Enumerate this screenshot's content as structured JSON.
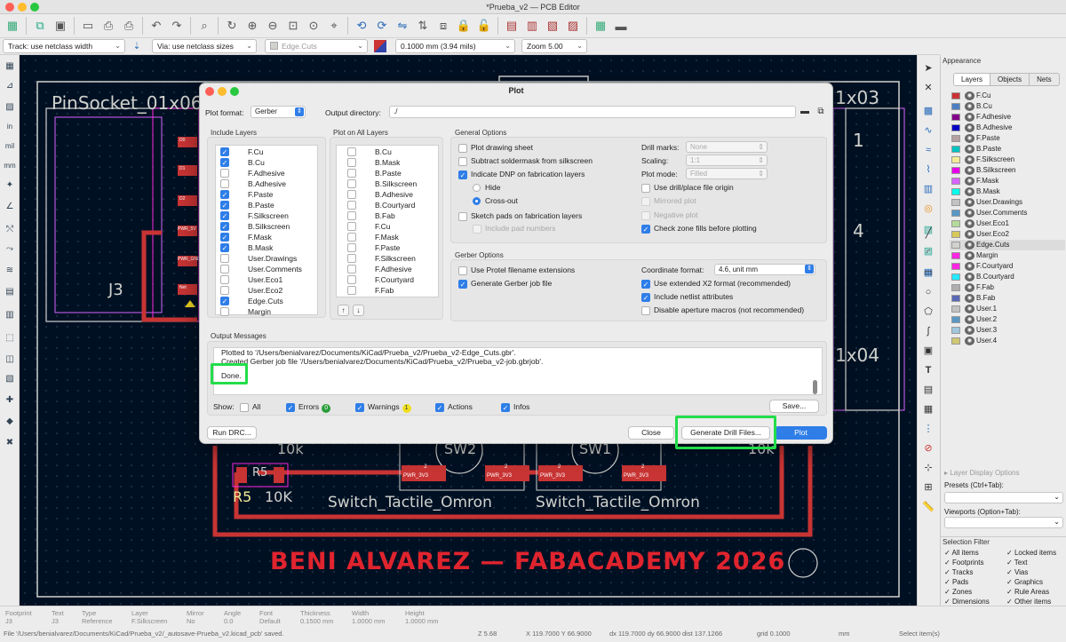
{
  "window": {
    "title": "*Prueba_v2 — PCB Editor"
  },
  "toolbar2": {
    "track": "Track: use netclass width",
    "via": "Via: use netclass sizes",
    "layer": "Edge.Cuts",
    "grid": "0.1000 mm (3.94 mils)",
    "zoom": "Zoom 5.00"
  },
  "left_toolbar": {
    "in_label": "in",
    "mil_label": "mil",
    "mm_label": "mm"
  },
  "canvas": {
    "pinsocket_label": "PinSocket_01x06",
    "ref_j3": "J3",
    "label_1x03": "1x03",
    "label_1x04": "1x04",
    "label_1": "1",
    "label_4": "4",
    "resistor_ref": "R5",
    "resistor_val": "10K",
    "resistor_pad_text": "R5",
    "val_10k_left": "10k",
    "val_10k_right": "10k",
    "sw2": "SW2",
    "sw1": "SW1",
    "switch_label": "Switch_Tactile_Omron",
    "pad_num": "2",
    "pad_net": "PWR_3V3",
    "footer_text": "BENI ALVAREZ — FABACADEMY 2026",
    "pin_labels": [
      "D0",
      "D1",
      "D2",
      "PWR_5V",
      "PWR_GND",
      "Net"
    ]
  },
  "dialog": {
    "title": "Plot",
    "plot_format_label": "Plot format:",
    "plot_format_value": "Gerber",
    "output_dir_label": "Output directory:",
    "output_dir_value": "./",
    "include_layers_title": "Include Layers",
    "include_layers": [
      {
        "name": "F.Cu",
        "checked": true
      },
      {
        "name": "B.Cu",
        "checked": true
      },
      {
        "name": "F.Adhesive",
        "checked": false
      },
      {
        "name": "B.Adhesive",
        "checked": false
      },
      {
        "name": "F.Paste",
        "checked": true
      },
      {
        "name": "B.Paste",
        "checked": true
      },
      {
        "name": "F.Silkscreen",
        "checked": true
      },
      {
        "name": "B.Silkscreen",
        "checked": true
      },
      {
        "name": "F.Mask",
        "checked": true
      },
      {
        "name": "B.Mask",
        "checked": true
      },
      {
        "name": "User.Drawings",
        "checked": false
      },
      {
        "name": "User.Comments",
        "checked": false
      },
      {
        "name": "User.Eco1",
        "checked": false
      },
      {
        "name": "User.Eco2",
        "checked": false
      },
      {
        "name": "Edge.Cuts",
        "checked": true
      },
      {
        "name": "Margin",
        "checked": false
      }
    ],
    "plot_all_title": "Plot on All Layers",
    "plot_all_layers": [
      "B.Cu",
      "B.Mask",
      "B.Paste",
      "B.Silkscreen",
      "B.Adhesive",
      "B.Courtyard",
      "B.Fab",
      "F.Cu",
      "F.Mask",
      "F.Paste",
      "F.Silkscreen",
      "F.Adhesive",
      "F.Courtyard",
      "F.Fab"
    ],
    "general_title": "General Options",
    "general": {
      "plot_drawing_sheet": "Plot drawing sheet",
      "subtract_soldermask": "Subtract soldermask from silkscreen",
      "indicate_dnp": "Indicate DNP on fabrication layers",
      "hide": "Hide",
      "cross_out": "Cross-out",
      "sketch_pads": "Sketch pads on fabrication layers",
      "include_pad_numbers": "Include pad numbers",
      "drill_marks_label": "Drill marks:",
      "drill_marks_value": "None",
      "scaling_label": "Scaling:",
      "scaling_value": "1:1",
      "plot_mode_label": "Plot mode:",
      "plot_mode_value": "Filled",
      "use_drill_origin": "Use drill/place file origin",
      "mirrored_plot": "Mirrored plot",
      "negative_plot": "Negative plot",
      "check_zone_fills": "Check zone fills before plotting"
    },
    "gerber_title": "Gerber Options",
    "gerber": {
      "protel": "Use Protel filename extensions",
      "job_file": "Generate Gerber job file",
      "coord_label": "Coordinate format:",
      "coord_value": "4.6, unit mm",
      "x2": "Use extended X2 format (recommended)",
      "netlist": "Include netlist attributes",
      "aperture": "Disable aperture macros (not recommended)"
    },
    "messages_title": "Output Messages",
    "messages": [
      "Plotted to '/Users/benialvarez/Documents/KiCad/Prueba_v2/Prueba_v2-Edge_Cuts.gbr'.",
      "Created Gerber job file '/Users/benialvarez/Documents/KiCad/Prueba_v2/Prueba_v2-job.gbrjob'.",
      "Done."
    ],
    "show_label": "Show:",
    "filters": {
      "all": "All",
      "errors": "Errors",
      "errors_count": "0",
      "warnings": "Warnings",
      "warnings_count": "1",
      "actions": "Actions",
      "infos": "Infos"
    },
    "save_btn": "Save...",
    "run_drc_btn": "Run DRC...",
    "close_btn": "Close",
    "drill_btn": "Generate Drill Files...",
    "plot_btn": "Plot"
  },
  "appearance": {
    "title": "Appearance",
    "tabs": [
      "Layers",
      "Objects",
      "Nets"
    ],
    "layers": [
      {
        "name": "F.Cu",
        "color": "#c83434"
      },
      {
        "name": "B.Cu",
        "color": "#4d7fc4"
      },
      {
        "name": "F.Adhesive",
        "color": "#84008a"
      },
      {
        "name": "B.Adhesive",
        "color": "#0000c4"
      },
      {
        "name": "F.Paste",
        "color": "#b4a0a0"
      },
      {
        "name": "B.Paste",
        "color": "#00c2c2"
      },
      {
        "name": "F.Silkscreen",
        "color": "#f2ed95"
      },
      {
        "name": "B.Silkscreen",
        "color": "#e800e8"
      },
      {
        "name": "F.Mask",
        "color": "#d864ff"
      },
      {
        "name": "B.Mask",
        "color": "#02ffee"
      },
      {
        "name": "User.Drawings",
        "color": "#c2c2c2"
      },
      {
        "name": "User.Comments",
        "color": "#5998c4"
      },
      {
        "name": "User.Eco1",
        "color": "#b4db99"
      },
      {
        "name": "User.Eco2",
        "color": "#d8c85a"
      },
      {
        "name": "Edge.Cuts",
        "color": "#d0d2cd"
      },
      {
        "name": "Margin",
        "color": "#ff26e2"
      },
      {
        "name": "F.Courtyard",
        "color": "#ff26e2"
      },
      {
        "name": "B.Courtyard",
        "color": "#26e9ff"
      },
      {
        "name": "F.Fab",
        "color": "#afafaf"
      },
      {
        "name": "B.Fab",
        "color": "#5868b4"
      },
      {
        "name": "User.1",
        "color": "#c2c2c2"
      },
      {
        "name": "User.2",
        "color": "#5998c4"
      },
      {
        "name": "User.3",
        "color": "#9fc7dd"
      },
      {
        "name": "User.4",
        "color": "#d0c874"
      }
    ],
    "layer_display_options": "Layer Display Options",
    "presets_label": "Presets (Ctrl+Tab):",
    "viewports_label": "Viewports (Option+Tab):",
    "selection_filter_title": "Selection Filter",
    "selection_filter": [
      "All items",
      "Locked items",
      "Footprints",
      "Text",
      "Tracks",
      "Vias",
      "Pads",
      "Graphics",
      "Zones",
      "Rule Areas",
      "Dimensions",
      "Other items"
    ]
  },
  "status": {
    "headers": [
      "Footprint",
      "Text",
      "Type",
      "Layer",
      "Mirror",
      "Angle",
      "Font",
      "Thickness",
      "Width",
      "Height"
    ],
    "values": [
      "J3",
      "J3",
      "Reference",
      "F.Silkscreen",
      "No",
      "0.0",
      "Default",
      "0.1500 mm",
      "1.0000 mm",
      "1.0000 mm"
    ],
    "file_msg": "File '/Users/benialvarez/Documents/KiCad/Prueba_v2/_autosave-Prueba_v2.kicad_pcb' saved.",
    "z": "Z 5.68",
    "xy": "X 119.7000  Y 66.9000",
    "dxdy": "dx 119.7000  dy 66.9000  dist 137.1266",
    "grid": "grid 0.1000",
    "unit": "mm",
    "select": "Select item(s)"
  }
}
